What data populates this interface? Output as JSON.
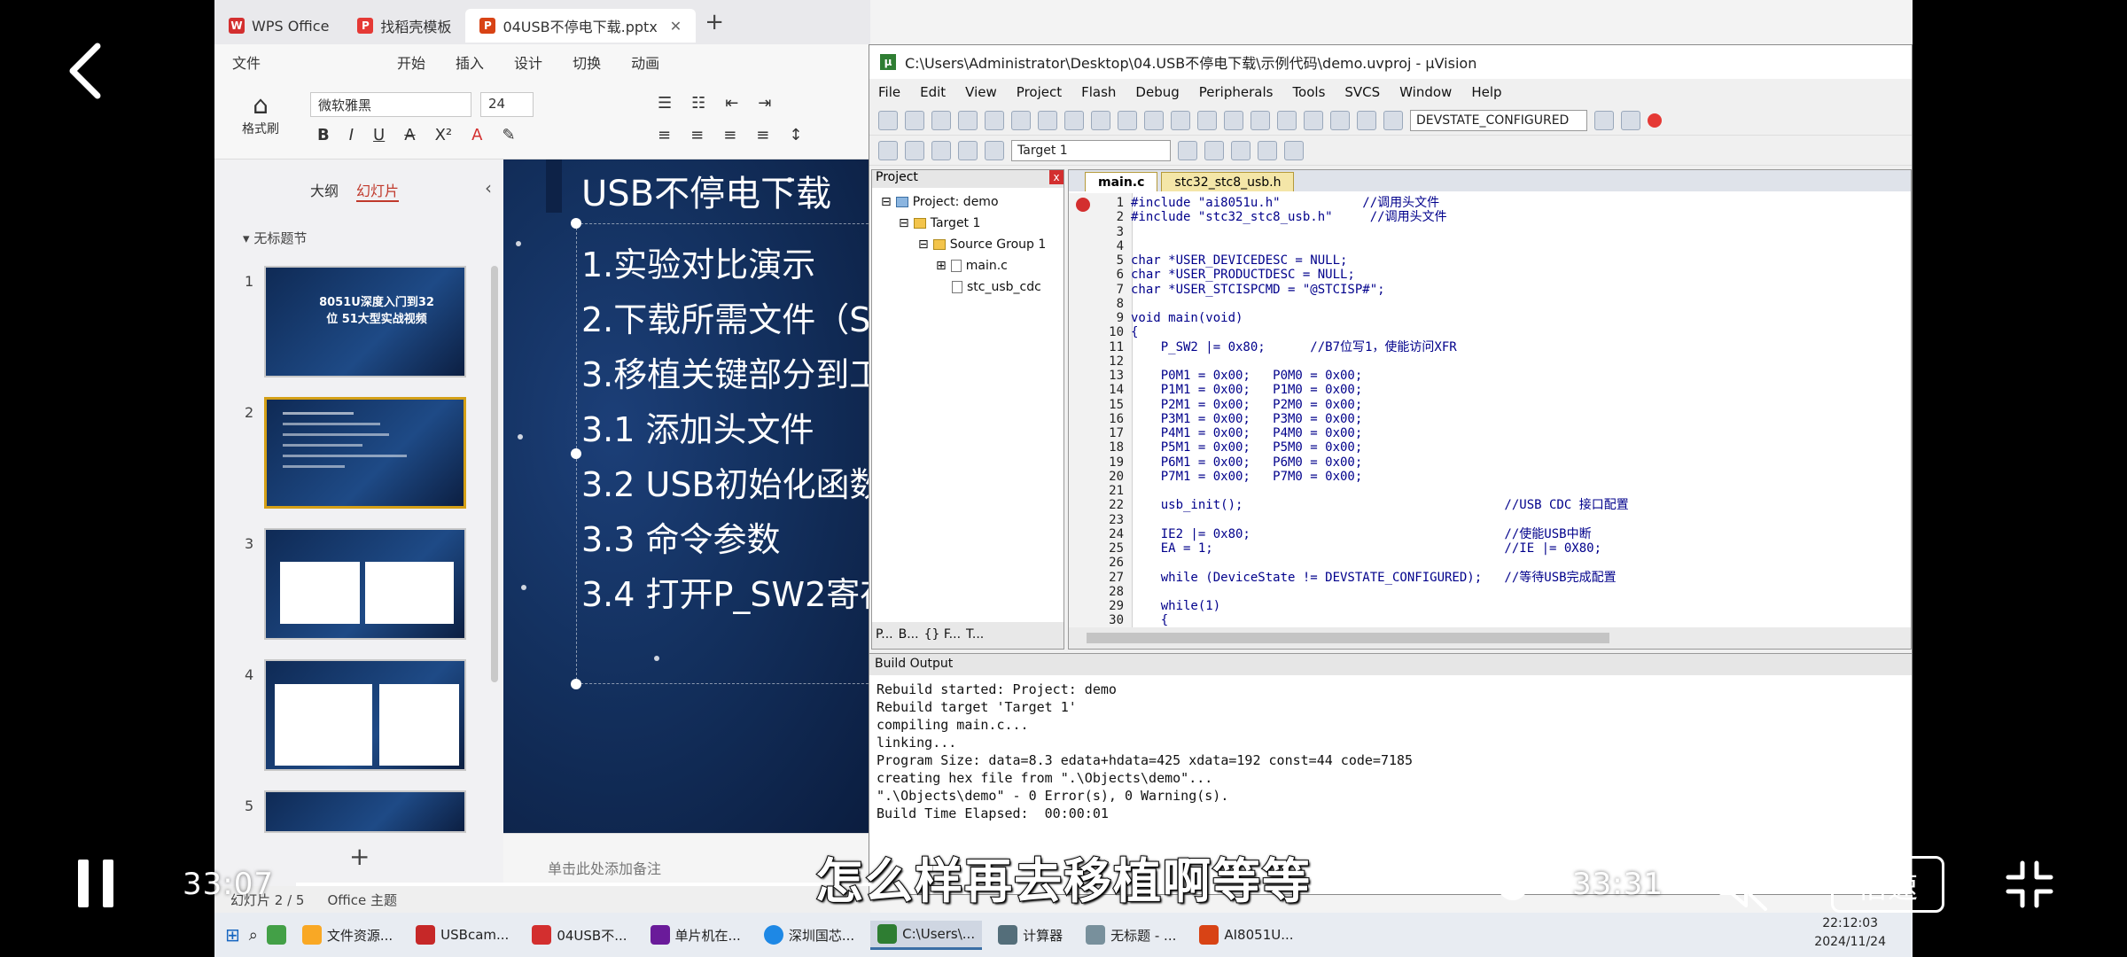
{
  "wps": {
    "tabs": [
      {
        "label": "WPS Office",
        "logo": "W",
        "color": "#d32f2f"
      },
      {
        "label": "找稻壳模板",
        "logo": "P",
        "color": "#e53935"
      },
      {
        "label": "04USB不停电下载.pptx",
        "logo": "P",
        "color": "#d84315"
      }
    ],
    "menu": [
      "文件",
      "开始",
      "插入",
      "设计",
      "切换",
      "动画"
    ],
    "format_brush": "格式刷",
    "font_name": "微软雅黑",
    "font_size": "24",
    "panel_tabs": [
      "大纲",
      "幻灯片"
    ],
    "section": "无标题节",
    "thumb1_title": "8051U深度入门到32位 51大型实战视频",
    "thumb_numbers": [
      "1",
      "2",
      "3",
      "4",
      "5"
    ],
    "notes_placeholder": "单击此处添加备注",
    "status_slide": "幻灯片 2 / 5",
    "status_theme": "Office 主题"
  },
  "slide": {
    "title": "USB不停电下载",
    "lines": [
      "1.实验对比演示",
      "2.下载所需文件（S",
      "3.移植关键部分到工",
      "3.1 添加头文件",
      "3.2 USB初始化函数",
      "3.3 命令参数",
      "3.4 打开P_SW2寄存"
    ]
  },
  "uvision": {
    "title": "C:\\Users\\Administrator\\Desktop\\04.USB不停电下载\\示例代码\\demo.uvproj - µVision",
    "menu": [
      "File",
      "Edit",
      "View",
      "Project",
      "Flash",
      "Debug",
      "Peripherals",
      "Tools",
      "SVCS",
      "Window",
      "Help"
    ],
    "toolbar_combo": "DEVSTATE_CONFIGURED",
    "target_combo": "Target 1",
    "project_pane_title": "Project",
    "tree": [
      "Project: demo",
      "Target 1",
      "Source Group 1",
      "main.c",
      "stc_usb_cdc"
    ],
    "proj_tabs": [
      "P...",
      "B...",
      "{} F...",
      "T..."
    ],
    "editor_tabs": [
      "main.c",
      "stc32_stc8_usb.h"
    ],
    "code": [
      {
        "n": "1",
        "t": "#include \"ai8051u.h\"           //调用头文件"
      },
      {
        "n": "2",
        "t": "#include \"stc32_stc8_usb.h\"     //调用头文件"
      },
      {
        "n": "3",
        "t": ""
      },
      {
        "n": "4",
        "t": ""
      },
      {
        "n": "5",
        "t": "char *USER_DEVICEDESC = NULL;"
      },
      {
        "n": "6",
        "t": "char *USER_PRODUCTDESC = NULL;"
      },
      {
        "n": "7",
        "t": "char *USER_STCISPCMD = \"@STCISP#\";"
      },
      {
        "n": "8",
        "t": ""
      },
      {
        "n": "9",
        "t": "void main(void)"
      },
      {
        "n": "10",
        "t": "{"
      },
      {
        "n": "11",
        "t": "    P_SW2 |= 0x80;      //B7位写1，使能访问XFR"
      },
      {
        "n": "12",
        "t": ""
      },
      {
        "n": "13",
        "t": "    P0M1 = 0x00;   P0M0 = 0x00;"
      },
      {
        "n": "14",
        "t": "    P1M1 = 0x00;   P1M0 = 0x00;"
      },
      {
        "n": "15",
        "t": "    P2M1 = 0x00;   P2M0 = 0x00;"
      },
      {
        "n": "16",
        "t": "    P3M1 = 0x00;   P3M0 = 0x00;"
      },
      {
        "n": "17",
        "t": "    P4M1 = 0x00;   P4M0 = 0x00;"
      },
      {
        "n": "18",
        "t": "    P5M1 = 0x00;   P5M0 = 0x00;"
      },
      {
        "n": "19",
        "t": "    P6M1 = 0x00;   P6M0 = 0x00;"
      },
      {
        "n": "20",
        "t": "    P7M1 = 0x00;   P7M0 = 0x00;"
      },
      {
        "n": "21",
        "t": ""
      },
      {
        "n": "22",
        "t": "    usb_init();                                   //USB CDC 接口配置"
      },
      {
        "n": "23",
        "t": ""
      },
      {
        "n": "24",
        "t": "    IE2 |= 0x80;                                  //使能USB中断"
      },
      {
        "n": "25",
        "t": "    EA = 1;                                       //IE |= 0X80;"
      },
      {
        "n": "26",
        "t": ""
      },
      {
        "n": "27",
        "t": "    while (DeviceState != DEVSTATE_CONFIGURED);   //等待USB完成配置"
      },
      {
        "n": "28",
        "t": ""
      },
      {
        "n": "29",
        "t": "    while(1)"
      },
      {
        "n": "30",
        "t": "    {"
      }
    ],
    "build_title": "Build Output",
    "build_lines": [
      "Rebuild started: Project: demo",
      "Rebuild target 'Target 1'",
      "compiling main.c...",
      "linking...",
      "Program Size: data=8.3 edata+hdata=425 xdata=192 const=44 code=7185",
      "creating hex file from \".\\Objects\\demo\"...",
      "\".\\Objects\\demo\" - 0 Error(s), 0 Warning(s).",
      "Build Time Elapsed:  00:00:01"
    ]
  },
  "taskbar": {
    "items": [
      "文件资源...",
      "USBcam...",
      "04USB不...",
      "单片机在...",
      "深圳国芯...",
      "C:\\Users\\...",
      "计算器",
      "无标题 - ...",
      "AI8051U..."
    ],
    "time": "22:12:03",
    "date": "2024/11/24"
  },
  "player": {
    "current_time": "33:07",
    "total_time": "33:31",
    "progress": 0.988,
    "subtitle": "怎么样再去移植啊等等",
    "speed_label": "倍速"
  }
}
